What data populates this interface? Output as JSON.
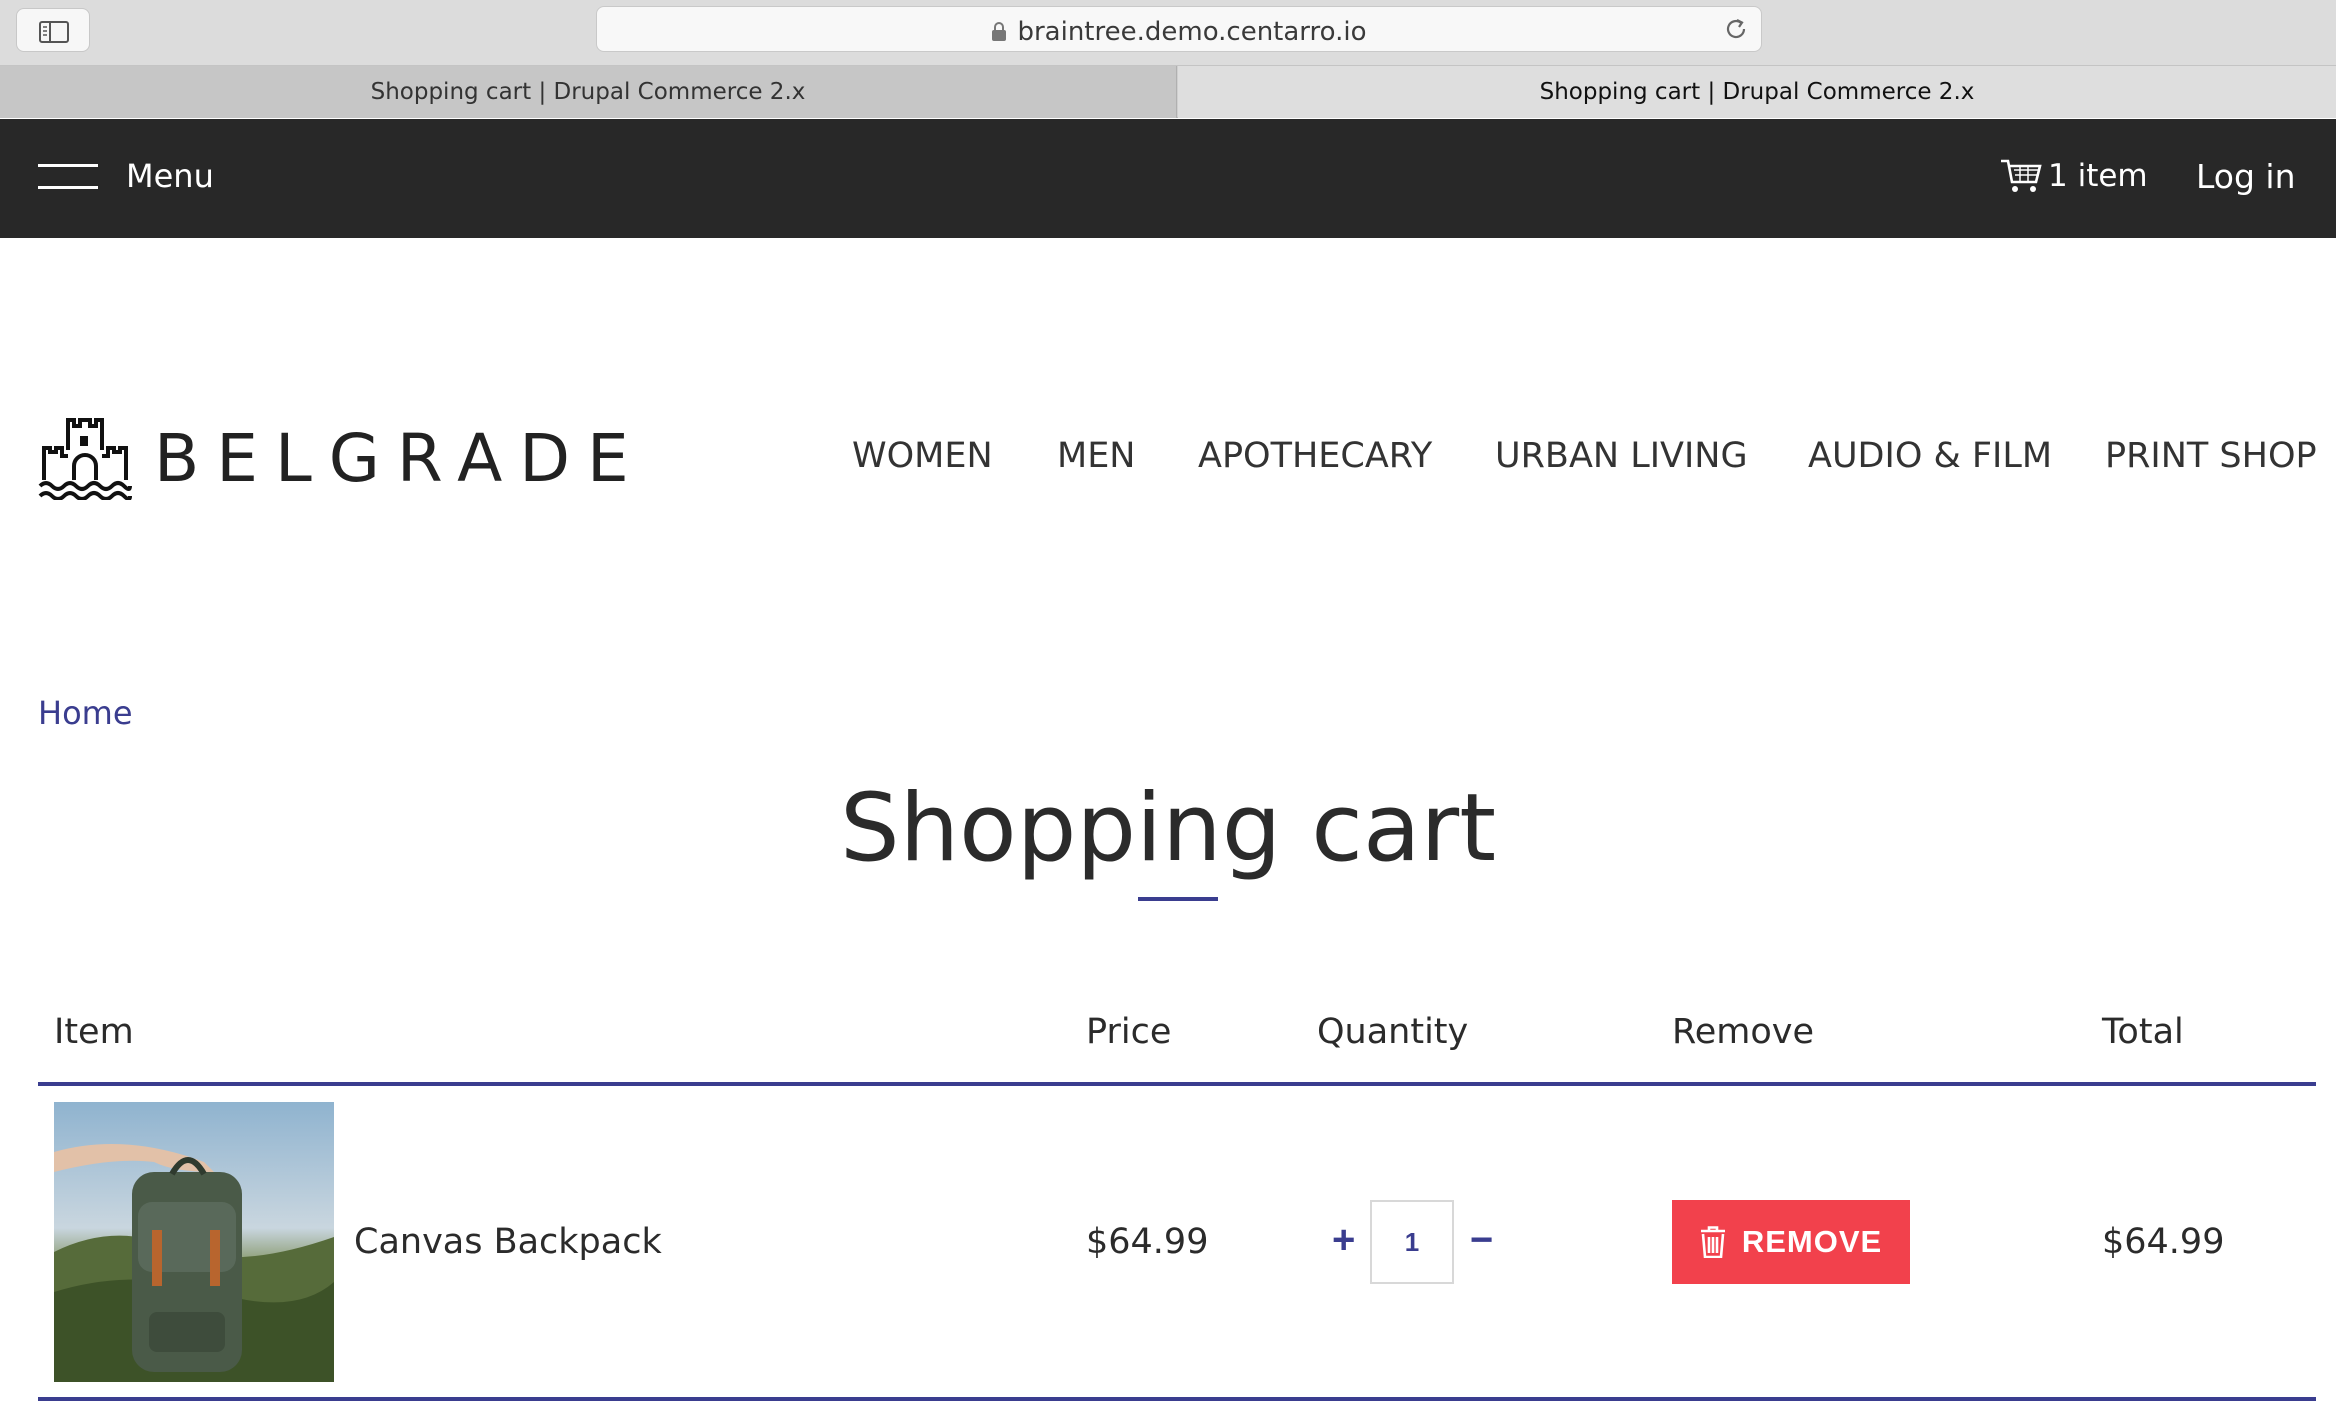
{
  "browser": {
    "url": "braintree.demo.centarro.io",
    "tabs": [
      {
        "label": "Shopping cart | Drupal Commerce 2.x",
        "active": false
      },
      {
        "label": "Shopping cart | Drupal Commerce 2.x",
        "active": true
      }
    ]
  },
  "topbar": {
    "menu_label": "Menu",
    "cart_label": "1 item",
    "login_label": "Log in"
  },
  "header": {
    "logo_text": "BELGRADE",
    "nav": [
      "WOMEN",
      "MEN",
      "APOTHECARY",
      "URBAN LIVING",
      "AUDIO & FILM",
      "PRINT SHOP"
    ]
  },
  "breadcrumb": {
    "home": "Home"
  },
  "page": {
    "title": "Shopping cart"
  },
  "cart": {
    "columns": [
      "Item",
      "Price",
      "Quantity",
      "Remove",
      "Total"
    ],
    "items": [
      {
        "name": "Canvas Backpack",
        "price": "$64.99",
        "quantity": "1",
        "plus": "+",
        "minus": "−",
        "remove_label": "REMOVE",
        "total": "$64.99"
      }
    ]
  },
  "colors": {
    "accent": "#3a3d8f",
    "remove": "#f2414c",
    "topbar": "#282828"
  }
}
